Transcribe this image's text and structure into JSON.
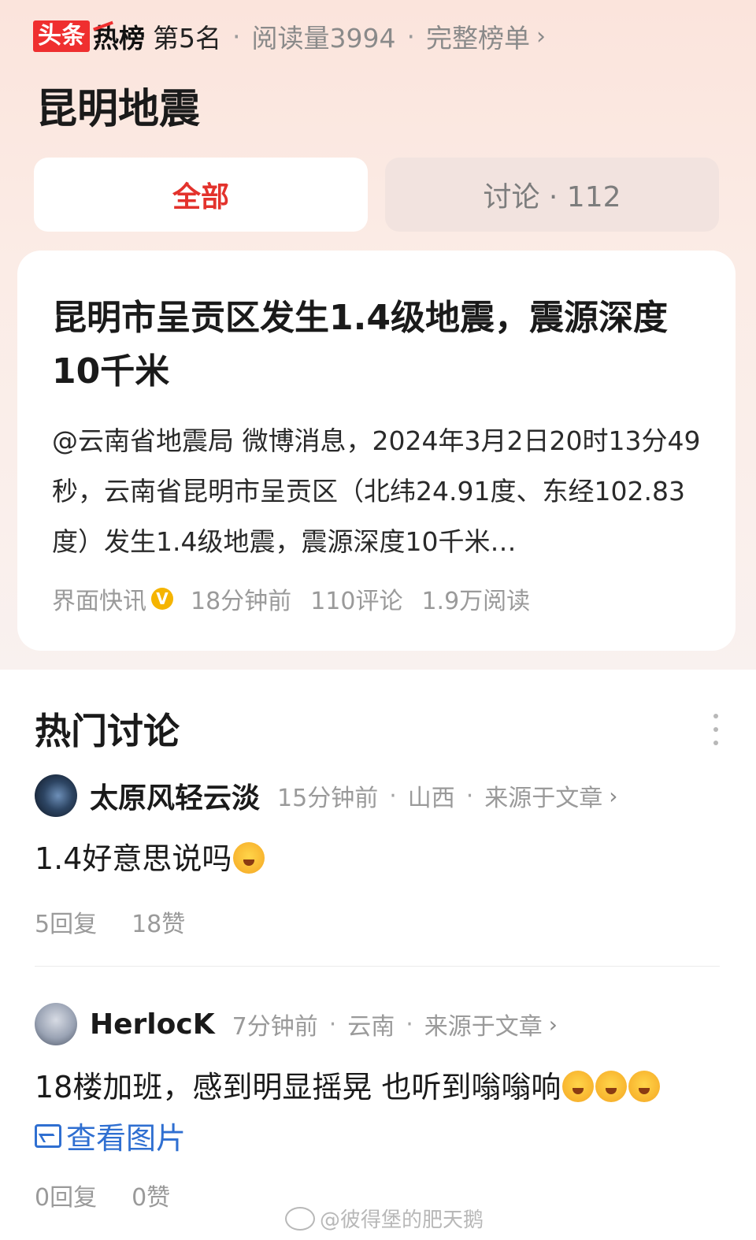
{
  "header": {
    "brand_box": "头条",
    "brand_hot": "热榜",
    "rank": "第5名",
    "reads": "阅读量3994",
    "full_list": "完整榜单",
    "topic": "昆明地震"
  },
  "tabs": {
    "all": "全部",
    "discuss": "讨论 · 112"
  },
  "news": {
    "title": "昆明市呈贡区发生1.4级地震，震源深度10千米",
    "body": "@云南省地震局 微博消息，2024年3月2日20时13分49秒，云南省昆明市呈贡区（北纬24.91度、东经102.83度）发生1.4级地震，震源深度10千米…",
    "source": "界面快讯",
    "verified": "V",
    "time": "18分钟前",
    "comments": "110评论",
    "reads": "1.9万阅读"
  },
  "section": {
    "title": "热门讨论"
  },
  "comments": [
    {
      "user": "太原风轻云淡",
      "time": "15分钟前",
      "location": "山西",
      "source": "来源于文章",
      "text": "1.4好意思说吗",
      "emoji": "crying-laughing-emoji",
      "replies": "5回复",
      "likes": "18赞"
    },
    {
      "user": "HerlocK",
      "time": "7分钟前",
      "location": "云南",
      "source": "来源于文章",
      "text": "18楼加班，感到明显摇晃 也听到嗡嗡响",
      "emoji": "shocked-emoji",
      "view_image": "查看图片",
      "replies": "0回复",
      "likes": "0赞"
    }
  ],
  "watermark": "@彼得堡的肥天鹅",
  "colors": {
    "accent": "#e3322c",
    "link": "#2f6fd1",
    "brand": "#ef2f2f"
  }
}
